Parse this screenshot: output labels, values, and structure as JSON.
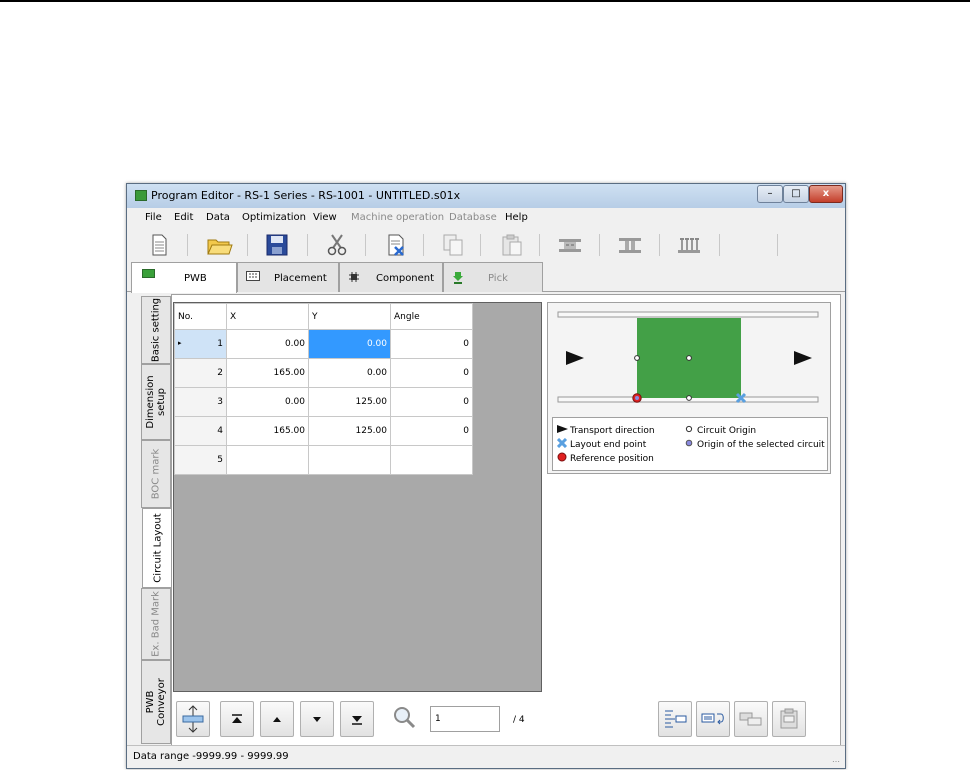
{
  "window": {
    "title": "Program Editor - RS-1 Series - RS-1001 - UNTITLED.s01x"
  },
  "window_controls": {
    "minimize": "–",
    "maximize": "□",
    "close": "x"
  },
  "menu": [
    {
      "label": "File",
      "enabled": true
    },
    {
      "label": "Edit",
      "enabled": true
    },
    {
      "label": "Data",
      "enabled": true
    },
    {
      "label": "Optimization",
      "enabled": true
    },
    {
      "label": "View",
      "enabled": true
    },
    {
      "label": "Machine operation",
      "enabled": false
    },
    {
      "label": "Database",
      "enabled": false
    },
    {
      "label": "Help",
      "enabled": true
    }
  ],
  "toolbar": [
    "new-file-icon",
    "open-folder-icon",
    "save-icon",
    "cut-icon",
    "delete-icon",
    "copy-icon",
    "paste-icon",
    "machine-a-icon",
    "machine-b-icon",
    "machine-c-icon"
  ],
  "top_tabs": [
    {
      "label": "PWB",
      "active": true,
      "enabled": true
    },
    {
      "label": "Placement",
      "active": false,
      "enabled": true
    },
    {
      "label": "Component",
      "active": false,
      "enabled": true
    },
    {
      "label": "Pick",
      "active": false,
      "enabled": false
    }
  ],
  "side_tabs": [
    {
      "label": "Basic setting",
      "enabled": true
    },
    {
      "label": "Dimension\nsetup",
      "enabled": true
    },
    {
      "label": "BOC mark",
      "enabled": false
    },
    {
      "label": "Circuit Layout",
      "enabled": true,
      "active": true
    },
    {
      "label": "Ex. Bad Mark",
      "enabled": false
    },
    {
      "label": "PWB\nConveyor",
      "enabled": true
    }
  ],
  "table": {
    "columns": [
      "No.",
      "X",
      "Y",
      "Angle"
    ],
    "rows": [
      {
        "no": "1",
        "x": "0.00",
        "y": "0.00",
        "angle": "0"
      },
      {
        "no": "2",
        "x": "165.00",
        "y": "0.00",
        "angle": "0"
      },
      {
        "no": "3",
        "x": "0.00",
        "y": "125.00",
        "angle": "0"
      },
      {
        "no": "4",
        "x": "165.00",
        "y": "125.00",
        "angle": "0"
      },
      {
        "no": "5",
        "x": "",
        "y": "",
        "angle": ""
      }
    ],
    "current_row": 1
  },
  "legend": {
    "transport": "Transport direction",
    "circuit_origin": "Circuit Origin",
    "layout_end": "Layout end point",
    "selected_origin": "Origin of the selected circuit",
    "reference": "Reference position"
  },
  "pager": {
    "current": "1",
    "total": "/ 4"
  },
  "status": {
    "text": "Data range  -9999.99 - 9999.99"
  },
  "colors": {
    "board": "#43a047",
    "selection": "#3399ff",
    "reference": "#e02020",
    "end_point": "#5aa0e0"
  }
}
